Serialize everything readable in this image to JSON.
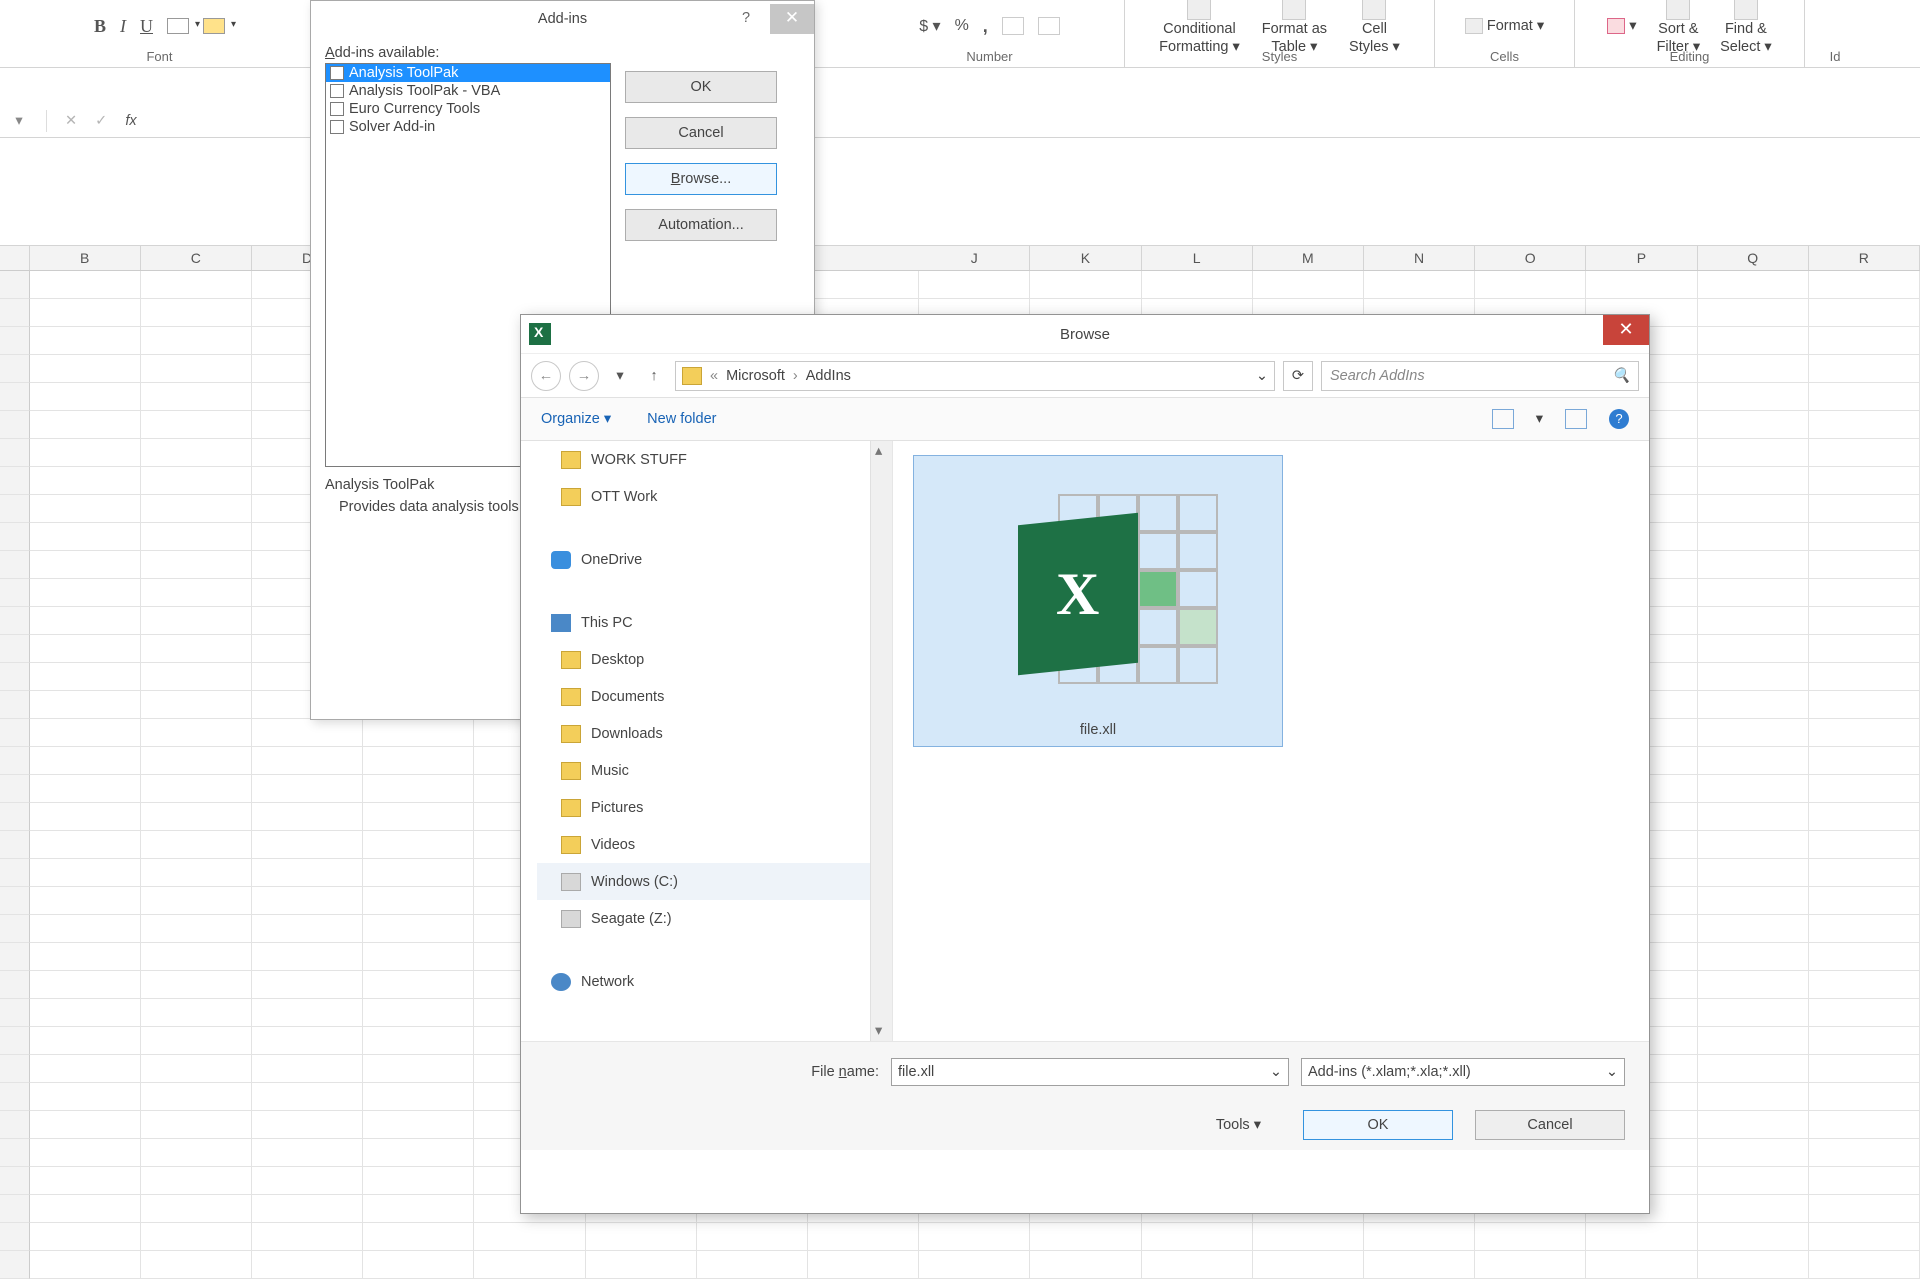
{
  "ribbon": {
    "font_group": "Font",
    "number_group": "Number",
    "styles_group": "Styles",
    "cells_group": "Cells",
    "editing_group": "Editing",
    "number_fmt_icons": [
      "$",
      "%",
      ","
    ],
    "cond_fmt_l1": "Conditional",
    "cond_fmt_l2": "Formatting ▾",
    "fmt_as_l1": "Format as",
    "fmt_as_l2": "Table ▾",
    "cell_styles_l1": "Cell",
    "cell_styles_l2": "Styles ▾",
    "format_btn": "Format ▾",
    "sort_l1": "Sort &",
    "sort_l2": "Filter ▾",
    "find_l1": "Find &",
    "find_l2": "Select ▾",
    "id_label": "Id"
  },
  "formula_bar": {
    "fx": "fx"
  },
  "columns": [
    "B",
    "C",
    "D",
    "J",
    "K",
    "L",
    "M",
    "N",
    "O",
    "P",
    "Q",
    "R"
  ],
  "addins": {
    "title": "Add-ins",
    "available_l": "A",
    "available_rest": "dd-ins available:",
    "items": [
      "Analysis ToolPak",
      "Analysis ToolPak - VBA",
      "Euro Currency Tools",
      "Solver Add-in"
    ],
    "ok": "OK",
    "cancel": "Cancel",
    "browse_u": "B",
    "browse_rest": "rowse...",
    "automation_a": "A",
    "automation_rest": "utomation...",
    "desc_title": "Analysis ToolPak",
    "desc_body": "Provides data analysis tools for statistical and engineering analysis."
  },
  "browse": {
    "title": "Browse",
    "crumb_pre": "«",
    "crumb_a": "Microsoft",
    "crumb_b": "AddIns",
    "search_ph": "Search AddIns",
    "organize": "Organize ▾",
    "newfolder": "New folder",
    "tree": {
      "work_stuff": "WORK STUFF",
      "ott": "OTT Work",
      "onedrive": "OneDrive",
      "this_pc": "This PC",
      "desktop": "Desktop",
      "documents": "Documents",
      "downloads": "Downloads",
      "music": "Music",
      "pictures": "Pictures",
      "videos": "Videos",
      "c": "Windows (C:)",
      "z": "Seagate (Z:)",
      "network": "Network"
    },
    "file_name": "file.xll",
    "fn_label_u": "n",
    "fn_label_pre": "File ",
    "fn_label_post": "ame:",
    "ftype": "Add-ins (*.xlam;*.xla;*.xll)",
    "tools": "Tools   ▾",
    "ok": "OK",
    "cancel": "Cancel"
  }
}
